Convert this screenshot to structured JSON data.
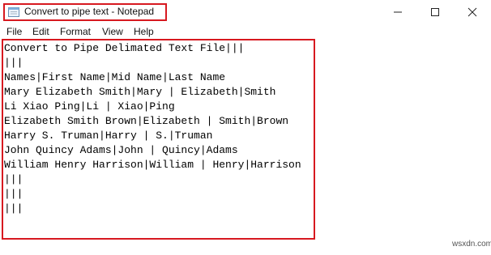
{
  "window": {
    "title": "Convert to pipe text - Notepad",
    "icon": "notepad-icon",
    "controls": {
      "minimize": "–",
      "maximize": "☐",
      "close": "✕"
    }
  },
  "menu": {
    "file": "File",
    "edit": "Edit",
    "format": "Format",
    "view": "View",
    "help": "Help"
  },
  "editor": {
    "lines": [
      "Convert to Pipe Delimated Text File|||",
      "|||",
      "Names|First Name|Mid Name|Last Name",
      "Mary Elizabeth Smith|Mary | Elizabeth|Smith",
      "Li Xiao Ping|Li | Xiao|Ping",
      "Elizabeth Smith Brown|Elizabeth | Smith|Brown",
      "Harry S. Truman|Harry | S.|Truman",
      "John Quincy Adams|John | Quincy|Adams",
      "William Henry Harrison|William | Henry|Harrison",
      "|||",
      "|||",
      "|||"
    ]
  },
  "watermark": "wsxdn.com",
  "colors": {
    "highlight": "#d71920",
    "background": "#ffffff"
  }
}
